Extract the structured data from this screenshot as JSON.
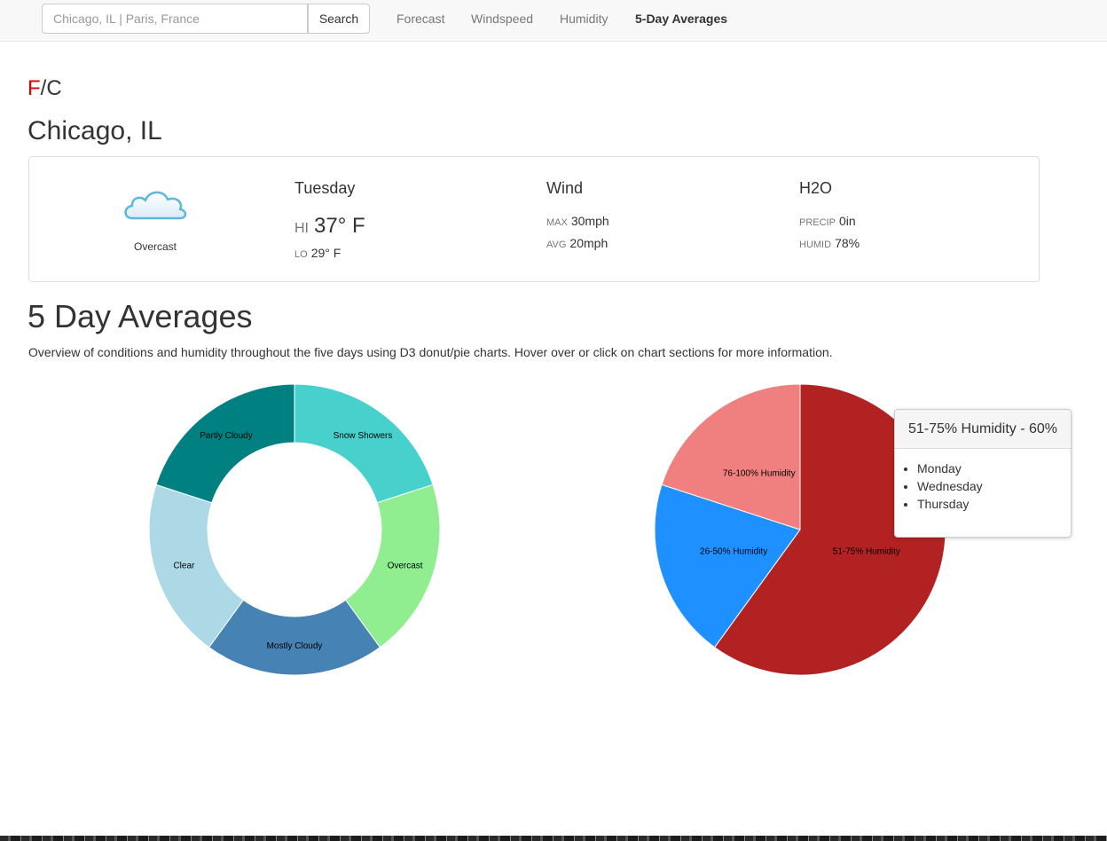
{
  "navbar": {
    "search_placeholder": "Chicago, IL | Paris, France",
    "search_button": "Search",
    "links": [
      "Forecast",
      "Windspeed",
      "Humidity",
      "5-Day Averages"
    ],
    "active_link": "5-Day Averages"
  },
  "units": {
    "f": "F",
    "separator": "/",
    "c": "C",
    "active": "F",
    "active_color": "#e00000"
  },
  "city": "Chicago, IL",
  "current": {
    "condition": "Overcast",
    "icon": "cloud-icon",
    "day": "Tuesday",
    "hi_label": "HI",
    "hi_value": "37° F",
    "lo_label": "LO",
    "lo_value": "29° F",
    "wind_title": "Wind",
    "wind_max_label": "MAX",
    "wind_max": "30mph",
    "wind_avg_label": "AVG",
    "wind_avg": "20mph",
    "h2o_title": "H2O",
    "precip_label": "PRECIP",
    "precip": "0in",
    "humid_label": "HUMID",
    "humid": "78%"
  },
  "averages": {
    "title": "5 Day Averages",
    "description": "Overview of conditions and humidity throughout the five days using D3 donut/pie charts. Hover over or click on chart sections for more information."
  },
  "chart_data": [
    {
      "type": "pie",
      "donut": true,
      "categories": [
        "Snow Showers",
        "Overcast",
        "Mostly Cloudy",
        "Clear",
        "Partly Cloudy"
      ],
      "values": [
        20,
        20,
        20,
        20,
        20
      ],
      "colors": [
        "#48d1cc",
        "#90ee90",
        "#4682b4",
        "#add8e6",
        "#008080"
      ]
    },
    {
      "type": "pie",
      "donut": false,
      "categories": [
        "51-75% Humidity",
        "26-50% Humidity",
        "76-100% Humidity"
      ],
      "values": [
        60,
        20,
        20
      ],
      "colors": [
        "#b22222",
        "#1e90ff",
        "#f08080"
      ]
    }
  ],
  "tooltip": {
    "title": "51-75% Humidity - 60%",
    "days": [
      "Monday",
      "Wednesday",
      "Thursday"
    ]
  }
}
